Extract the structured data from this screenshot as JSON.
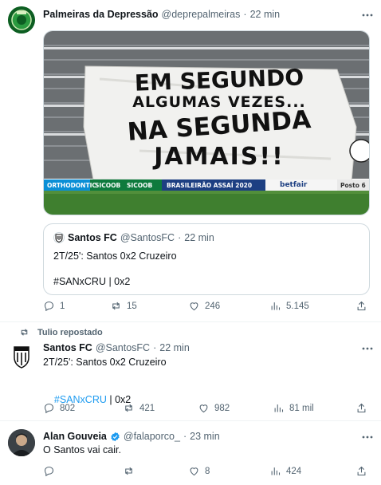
{
  "tweet1": {
    "name": "Palmeiras da Depressão",
    "handle": "@deprepalmeiras",
    "dot": "·",
    "time": "22 min",
    "banner": {
      "line1": "EM SEGUNDO",
      "line2": "ALGUMAS VEZES...",
      "line3": "NA SEGUNDA",
      "line4": "JAMAIS!!",
      "ads": [
        "ORTHODONTIC",
        "SICOOB",
        "SICOOB",
        "BRASILEIRÃO ASSAÍ 2020",
        "betfair",
        "Posto 6"
      ]
    },
    "quote": {
      "name": "Santos FC",
      "handle": "@SantosFC",
      "dot": "·",
      "time": "22 min",
      "text": "2T/25': Santos 0x2 Cruzeiro",
      "hashtags": "#SANxCRU | 0x2"
    },
    "actions": {
      "replies": "1",
      "reposts": "15",
      "likes": "246",
      "views": "5.145"
    }
  },
  "tweet2": {
    "repost_label": "Tulio repostado",
    "name": "Santos FC",
    "handle": "@SantosFC",
    "dot": "·",
    "time": "22 min",
    "text": "2T/25': Santos 0x2 Cruzeiro",
    "hashtag": "#SANxCRU",
    "hashtag_rest": " | 0x2",
    "actions": {
      "replies": "802",
      "reposts": "421",
      "likes": "982",
      "views": "81 mil"
    }
  },
  "tweet3": {
    "name": "Alan Gouveia",
    "handle": "@falaporco_",
    "dot": "·",
    "time": "23 min",
    "text": "O Santos vai cair.",
    "actions": {
      "replies": "",
      "reposts": "",
      "likes": "8",
      "views": "424"
    }
  },
  "colors": {
    "accent": "#1d9bf0",
    "muted": "#536471",
    "border": "#cfd9de",
    "verified": "#1d9bf0"
  },
  "icons": [
    "more-icon",
    "reply-icon",
    "repost-icon",
    "like-icon",
    "views-icon",
    "share-icon",
    "verified-icon"
  ]
}
